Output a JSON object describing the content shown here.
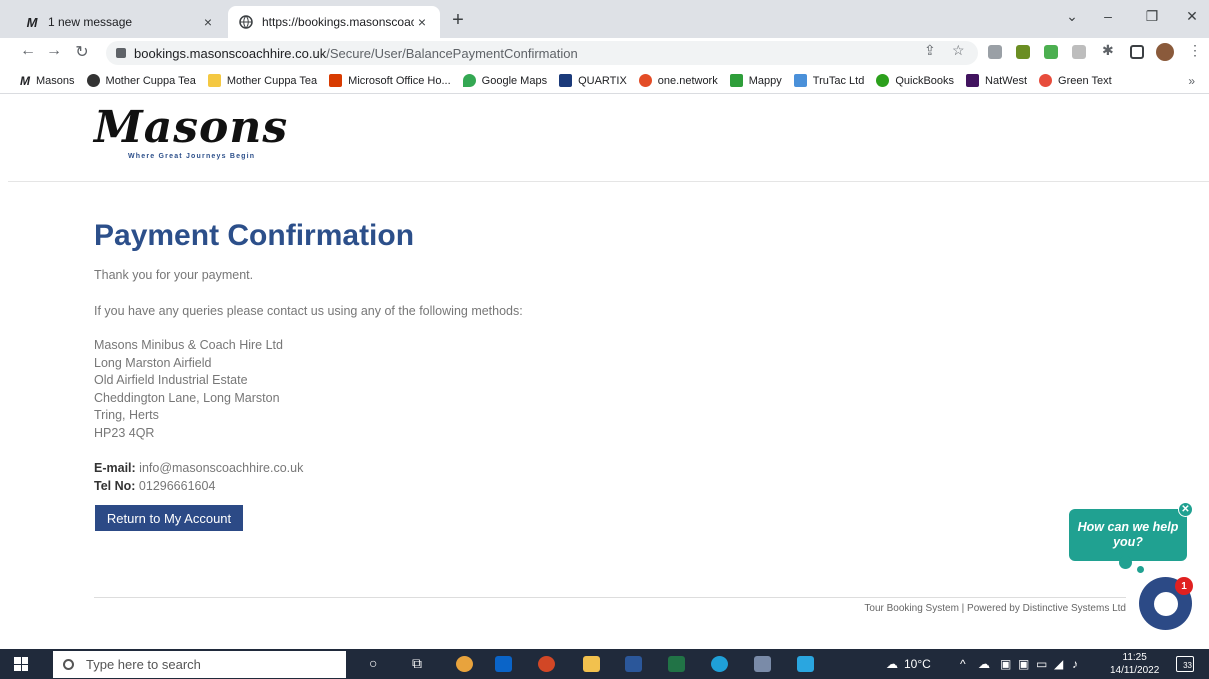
{
  "browser": {
    "tabs": [
      {
        "favicon": "M",
        "title": "1 new message"
      },
      {
        "title": "https://bookings.masonscoachhi",
        "favicon": "globe-icon"
      }
    ],
    "url_host": "bookings.masonscoachhire.co.uk",
    "url_path": "/Secure/User/BalancePaymentConfirmation",
    "bookmarks": [
      {
        "label": "Masons",
        "color": "#000000"
      },
      {
        "label": "Mother Cuppa Tea",
        "color": "#333333"
      },
      {
        "label": "Mother Cuppa Tea",
        "color": "#f4c842"
      },
      {
        "label": "Microsoft Office Ho...",
        "color": "#d83b01"
      },
      {
        "label": "Google Maps",
        "color": "#34a853"
      },
      {
        "label": "QUARTIX",
        "color": "#1b3a7a"
      },
      {
        "label": "one.network",
        "color": "#e34c26"
      },
      {
        "label": "Mappy",
        "color": "#2e9e3a"
      },
      {
        "label": "TruTac Ltd",
        "color": "#4a90d9"
      },
      {
        "label": "QuickBooks",
        "color": "#2ca01c"
      },
      {
        "label": "NatWest",
        "color": "#42145f"
      },
      {
        "label": "Green Text",
        "color": "#e74c3c"
      }
    ]
  },
  "page": {
    "logo": "Masons",
    "tagline": "Where Great Journeys Begin",
    "title": "Payment Confirmation",
    "thanks": "Thank you for your payment.",
    "queries": "If you have any queries please contact us using any of the following methods:",
    "address": [
      "Masons Minibus & Coach Hire Ltd",
      "Long Marston Airfield",
      "Old Airfield Industrial Estate",
      "Cheddington Lane, Long Marston",
      "Tring, Herts",
      "HP23 4QR"
    ],
    "email_label": "E-mail:",
    "email": "info@masonscoachhire.co.uk",
    "tel_label": "Tel No:",
    "tel": "01296661604",
    "button": "Return to My Account",
    "footer": "Tour Booking System | Powered by Distinctive Systems Ltd"
  },
  "chat": {
    "prompt": "How can we help you?",
    "badge": "1"
  },
  "taskbar": {
    "search_placeholder": "Type here to search",
    "weather": "10°C",
    "time": "11:25",
    "date": "14/11/2022",
    "notifications": "33"
  }
}
